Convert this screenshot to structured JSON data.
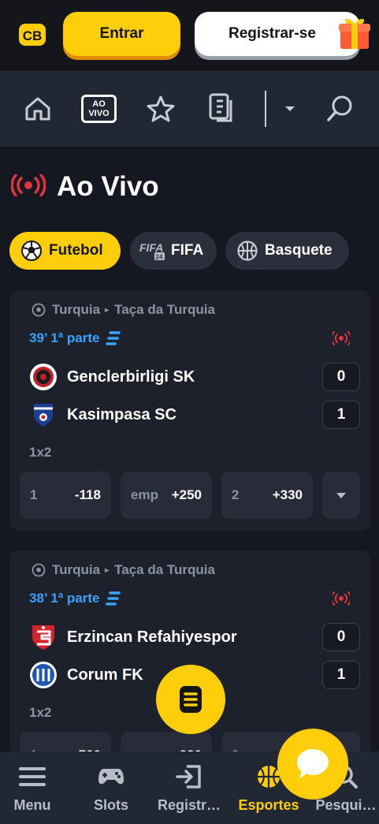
{
  "header": {
    "logo_text": "CB",
    "login_label": "Entrar",
    "register_label": "Registrar-se"
  },
  "nav": {
    "home_icon": "home-icon",
    "live_box_line1": "AO",
    "live_box_line2": "VIVO",
    "favorites_icon": "star-icon",
    "betslip_icon": "document-icon",
    "dropdown_icon": "caret-down-icon",
    "search_icon": "search-icon"
  },
  "page": {
    "title": "Ao Vivo"
  },
  "sport_tabs": [
    {
      "label": "Futebol",
      "active": true
    },
    {
      "label": "FIFA",
      "active": false
    },
    {
      "label": "Basquete",
      "active": false
    }
  ],
  "events": [
    {
      "country": "Turquia",
      "league": "Taça da Turquia",
      "time": "39’ 1ª parte",
      "home": {
        "name": "Genclerbirligi SK",
        "score": "0"
      },
      "away": {
        "name": "Kasimpasa SC",
        "score": "1"
      },
      "market": "1x2",
      "odds": [
        {
          "label": "1",
          "value": "-118"
        },
        {
          "label": "emp",
          "value": "+250"
        },
        {
          "label": "2",
          "value": "+330"
        }
      ]
    },
    {
      "country": "Turquia",
      "league": "Taça da Turquia",
      "time": "38’ 1ª parte",
      "home": {
        "name": "Erzincan Refahiyespor",
        "score": "0"
      },
      "away": {
        "name": "Corum FK",
        "score": "1"
      },
      "market": "1x2",
      "odds": [
        {
          "label": "1",
          "value": "+700"
        },
        {
          "label": "emp",
          "value": "+280"
        },
        {
          "label": "2",
          "value": ""
        }
      ]
    }
  ],
  "bottom_nav": [
    {
      "label": "Menu",
      "icon": "menu-icon",
      "active": false
    },
    {
      "label": "Slots",
      "icon": "gamepad-icon",
      "active": false
    },
    {
      "label": "Registr…",
      "icon": "login-icon",
      "active": false
    },
    {
      "label": "Esportes",
      "icon": "basketball-icon",
      "active": true
    },
    {
      "label": "Pesqui…",
      "icon": "search-icon",
      "active": false
    }
  ],
  "colors": {
    "accent": "#ffce0a",
    "background": "#151820",
    "card": "#1d212b",
    "live_blue": "#3aa3ff",
    "live_red": "#e0353f"
  }
}
